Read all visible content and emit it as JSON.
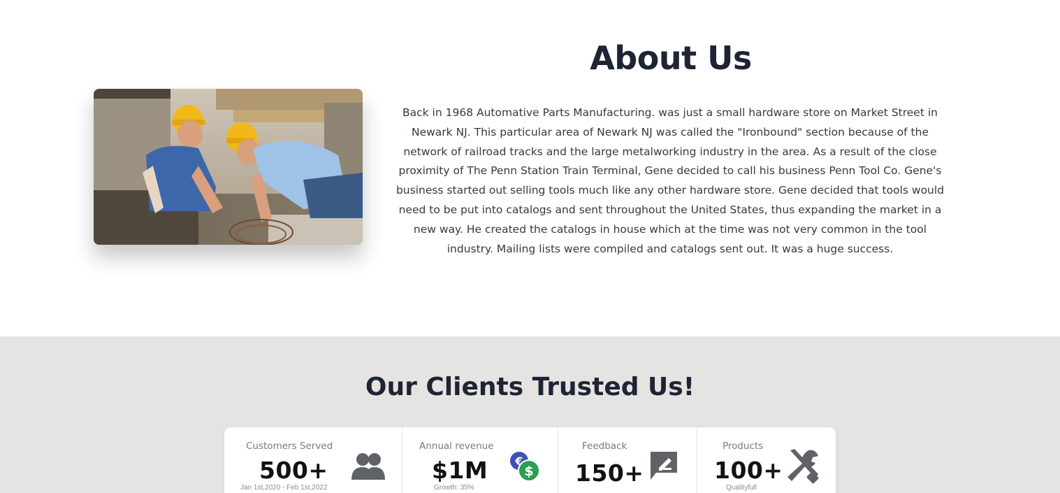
{
  "about": {
    "title": "About Us",
    "paragraph": "Back in 1968 Automative Parts Manufacturing. was just a small hardware store on Market Street in Newark NJ. This particular area of Newark NJ was called the \"Ironbound\" section because of the network of railroad tracks and the large metalworking industry in the area. As a result of the close proximity of The Penn Station Train Terminal, Gene decided to call his business Penn Tool Co. Gene's business started out selling tools much like any other hardware store. Gene decided that tools would need to be put into catalogs and sent throughout the United States, thus expanding the market in a new way. He created the catalogs in house which at the time was not very common in the tool industry. Mailing lists were compiled and catalogs sent out. It was a huge success.",
    "image_icon": "construction-workers-photo"
  },
  "trust": {
    "title": "Our Clients Trusted Us!",
    "stats": [
      {
        "label": "Customers Served",
        "value": "500+",
        "sub": "Jan 1st,2020 - Feb 1st,2022",
        "icon": "users-icon"
      },
      {
        "label": "Annual revenue",
        "value": "$1M",
        "sub": "Growth: 35%",
        "icon": "currency-exchange-icon"
      },
      {
        "label": "Feedback",
        "value": "150+",
        "sub": "",
        "icon": "feedback-icon"
      },
      {
        "label": "Products",
        "value": "100+",
        "sub": "Qualityfull",
        "icon": "tools-icon"
      }
    ]
  },
  "colors": {
    "heading": "#1e2433",
    "section_bg": "#e5e4e2",
    "icon_gray": "#5f6368",
    "euro_blue": "#3f51b5",
    "dollar_green": "#2e9e4f"
  }
}
